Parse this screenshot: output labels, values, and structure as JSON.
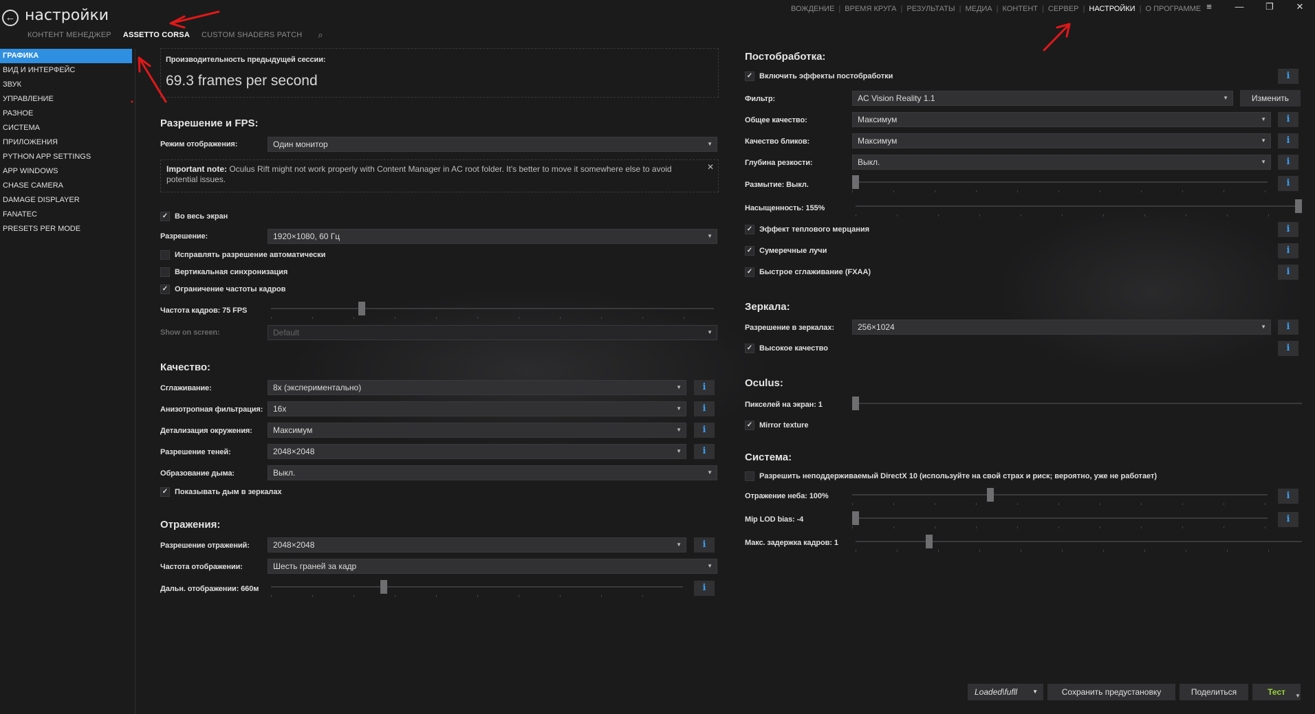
{
  "header": {
    "title": "настройки",
    "subtabs": [
      "КОНТЕНТ МЕНЕДЖЕР",
      "ASSETTO CORSA",
      "CUSTOM SHADERS PATCH"
    ],
    "active_subtab": "ASSETTO CORSA",
    "search_icon": "search-icon"
  },
  "topnav": {
    "items": [
      "ВОЖДЕНИЕ",
      "ВРЕМЯ КРУГА",
      "РЕЗУЛЬТАТЫ",
      "МЕДИА",
      "КОНТЕНТ",
      "СЕРВЕР",
      "НАСТРОЙКИ",
      "О ПРОГРАММЕ"
    ],
    "active": "НАСТРОЙКИ"
  },
  "window_buttons": {
    "menu": "≡",
    "minimize": "—",
    "restore": "❐",
    "close": "✕"
  },
  "sidebar": {
    "items": [
      "ГРАФИКА",
      "ВИД И ИНТЕРФЕЙС",
      "ЗВУК",
      "УПРАВЛЕНИЕ",
      "РАЗНОЕ",
      "СИСТЕМА",
      "ПРИЛОЖЕНИЯ",
      "PYTHON APP SETTINGS",
      "APP WINDOWS",
      "CHASE CAMERA",
      "DAMAGE DISPLAYER",
      "FANATEC",
      "PRESETS PER MODE"
    ],
    "active": "ГРАФИКА"
  },
  "perf": {
    "label": "Производительность предыдущей сессии:",
    "value": "69.3 frames per second"
  },
  "resolution_fps": {
    "title": "Разрешение и FPS:",
    "display_mode_label": "Режим отображения:",
    "display_mode_value": "Один монитор",
    "note_bold": "Important note:",
    "note_text": " Oculus Rift might not work properly with Content Manager in AC root folder. It's better to move it somewhere else to avoid potential issues.",
    "fullscreen_label": "Во весь экран",
    "fullscreen_checked": true,
    "resolution_label": "Разрешение:",
    "resolution_value": "1920×1080, 60 Гц",
    "auto_fix_label": "Исправлять разрешение автоматически",
    "auto_fix_checked": false,
    "vsync_label": "Вертикальная синхронизация",
    "vsync_checked": false,
    "fps_limit_label": "Ограничение частоты кадров",
    "fps_limit_checked": true,
    "framerate_label": "Частота кадров: 75 FPS",
    "framerate_level": 0.2,
    "show_on_screen_label": "Show on screen:",
    "show_on_screen_value": "Default"
  },
  "quality": {
    "title": "Качество:",
    "aa_label": "Сглаживание:",
    "aa_value": "8x (экспериментально)",
    "aniso_label": "Анизотропная фильтрация:",
    "aniso_value": "16x",
    "world_detail_label": "Детализация окружения:",
    "world_detail_value": "Максимум",
    "shadows_label": "Разрешение теней:",
    "shadows_value": "2048×2048",
    "smoke_label": "Образование дыма:",
    "smoke_value": "Выкл.",
    "smoke_mirrors_label": "Показывать дым в зеркалах",
    "smoke_mirrors_checked": true
  },
  "reflections": {
    "title": "Отражения:",
    "res_label": "Разрешение отражений:",
    "res_value": "2048×2048",
    "freq_label": "Частота отображении:",
    "freq_value": "Шесть граней за кадр",
    "distance_label": "Дальн. отображении: 660м",
    "distance_level": 0.27
  },
  "postprocess": {
    "title": "Постобработка:",
    "enable_label": "Включить эффекты постобработки",
    "enable_checked": true,
    "filter_label": "Фильтр:",
    "filter_value": "AC Vision Reality 1.1",
    "change_button": "Изменить",
    "overall_label": "Общее качество:",
    "overall_value": "Максимум",
    "glare_label": "Качество бликов:",
    "glare_value": "Максимум",
    "dof_label": "Глубина резкости:",
    "dof_value": "Выкл.",
    "blur_label": "Размытие: Выкл.",
    "blur_level": 0.0,
    "saturation_label": "Насыщенность: 155%",
    "saturation_level": 1.0,
    "heat_label": "Эффект теплового мерцания",
    "heat_checked": true,
    "sunrays_label": "Сумеречные лучи",
    "sunrays_checked": true,
    "fxaa_label": "Быстрое сглаживание (FXAA)",
    "fxaa_checked": true
  },
  "mirrors": {
    "title": "Зеркала:",
    "res_label": "Разрешение в зеркалах:",
    "res_value": "256×1024",
    "hq_label": "Высокое качество",
    "hq_checked": true
  },
  "oculus": {
    "title": "Oculus:",
    "pixels_label": "Пикселей на экран: 1",
    "pixels_level": 0.0,
    "mirror_texture_label": "Mirror texture",
    "mirror_texture_checked": true
  },
  "system": {
    "title": "Система:",
    "dx10_label": "Разрешить неподдерживаемый DirectX 10 (используйте на свой страх и риск; вероятно, уже не работает)",
    "dx10_checked": false,
    "sky_label": "Отражение неба: 100%",
    "sky_level": 0.33,
    "mip_label": "Mip LOD bias: -4",
    "mip_level": 0.0,
    "latency_label": "Макс. задержка кадров: 1",
    "latency_level": 0.16
  },
  "footer": {
    "preset_value": "Loaded\\fufll",
    "save_button": "Сохранить предустановку",
    "share_button": "Поделиться",
    "test_button": "Тест"
  },
  "colors": {
    "accent": "#2f8fe0",
    "info": "#3a9df0",
    "arrow": "#e01818",
    "test_button": "#9ad33b"
  }
}
